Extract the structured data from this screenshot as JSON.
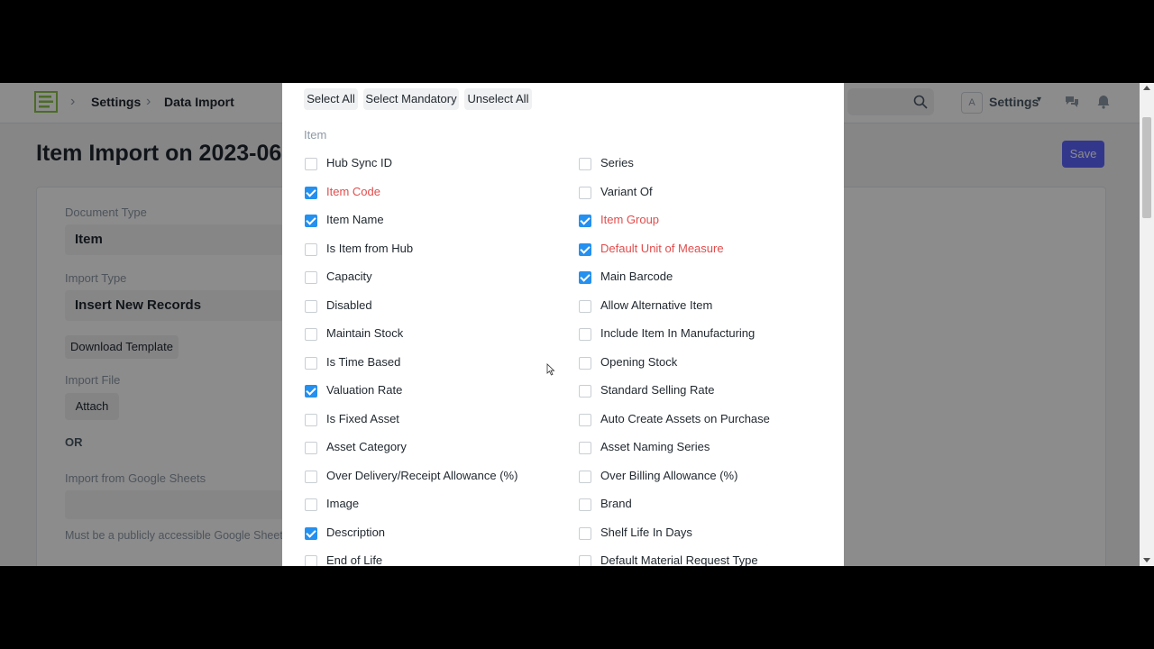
{
  "navbar": {
    "breadcrumbs": [
      "Settings",
      "Data Import"
    ],
    "user_initial": "A",
    "settings_label": "Settings"
  },
  "page": {
    "title": "Item Import on 2023-06",
    "save_label": "Save"
  },
  "form": {
    "document_type_label": "Document Type",
    "document_type_value": "Item",
    "import_type_label": "Import Type",
    "import_type_value": "Insert New Records",
    "download_template_label": "Download Template",
    "import_file_label": "Import File",
    "attach_label": "Attach",
    "or_label": "OR",
    "google_sheets_label": "Import from Google Sheets",
    "google_sheets_value": "",
    "google_sheets_help": "Must be a publicly accessible Google Sheets"
  },
  "modal": {
    "select_all_label": "Select All",
    "select_mandatory_label": "Select Mandatory",
    "unselect_all_label": "Unselect All",
    "section_label": "Item",
    "fields": [
      {
        "label": "Hub Sync ID",
        "checked": false,
        "required": false
      },
      {
        "label": "Series",
        "checked": false,
        "required": false
      },
      {
        "label": "Item Code",
        "checked": true,
        "required": true
      },
      {
        "label": "Variant Of",
        "checked": false,
        "required": false
      },
      {
        "label": "Item Name",
        "checked": true,
        "required": false
      },
      {
        "label": "Item Group",
        "checked": true,
        "required": true
      },
      {
        "label": "Is Item from Hub",
        "checked": false,
        "required": false
      },
      {
        "label": "Default Unit of Measure",
        "checked": true,
        "required": true
      },
      {
        "label": "Capacity",
        "checked": false,
        "required": false
      },
      {
        "label": "Main Barcode",
        "checked": true,
        "required": false
      },
      {
        "label": "Disabled",
        "checked": false,
        "required": false
      },
      {
        "label": "Allow Alternative Item",
        "checked": false,
        "required": false
      },
      {
        "label": "Maintain Stock",
        "checked": false,
        "required": false
      },
      {
        "label": "Include Item In Manufacturing",
        "checked": false,
        "required": false
      },
      {
        "label": "Is Time Based",
        "checked": false,
        "required": false
      },
      {
        "label": "Opening Stock",
        "checked": false,
        "required": false
      },
      {
        "label": "Valuation Rate",
        "checked": true,
        "required": false
      },
      {
        "label": "Standard Selling Rate",
        "checked": false,
        "required": false
      },
      {
        "label": "Is Fixed Asset",
        "checked": false,
        "required": false
      },
      {
        "label": "Auto Create Assets on Purchase",
        "checked": false,
        "required": false
      },
      {
        "label": "Asset Category",
        "checked": false,
        "required": false
      },
      {
        "label": "Asset Naming Series",
        "checked": false,
        "required": false
      },
      {
        "label": "Over Delivery/Receipt Allowance (%)",
        "checked": false,
        "required": false
      },
      {
        "label": "Over Billing Allowance (%)",
        "checked": false,
        "required": false
      },
      {
        "label": "Image",
        "checked": false,
        "required": false
      },
      {
        "label": "Brand",
        "checked": false,
        "required": false
      },
      {
        "label": "Description",
        "checked": true,
        "required": false
      },
      {
        "label": "Shelf Life In Days",
        "checked": false,
        "required": false
      },
      {
        "label": "End of Life",
        "checked": false,
        "required": false
      },
      {
        "label": "Default Material Request Type",
        "checked": false,
        "required": false
      }
    ]
  },
  "colors": {
    "primary": "#5e64ff",
    "checkbox_checked": "#2490ef",
    "required_text": "#e24c4c"
  }
}
